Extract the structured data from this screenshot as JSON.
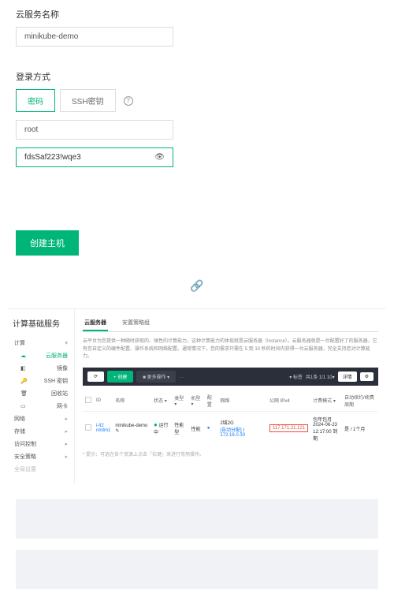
{
  "form": {
    "name_label": "云服务名称",
    "name_value": "minikube-demo",
    "login_label": "登录方式",
    "tab_password": "密码",
    "tab_ssh": "SSH密钥",
    "user_value": "root",
    "pwd_value": "fdsSaf223!wqe3"
  },
  "create_btn": "创建主机",
  "console": {
    "side_title": "计算基础服务",
    "menu": {
      "compute": "计算",
      "server": "云服务器",
      "image": "镜像",
      "ssh": "SSH 密钥",
      "recycle": "回收站",
      "nic": "网卡",
      "network": "网络",
      "storage": "存储",
      "access": "访问控制",
      "security": "安全策略",
      "global": "全局设置"
    },
    "tabs": {
      "t1": "云服务器",
      "t2": "安置策略组"
    },
    "desc": "云平台为您提供一种随时获取的、弹性的计算能力，这种计算能力的体现就是云服务器（Instance）。云服务器就是一台配置好了的服务器，它有您自定义的硬件配置、操作系统和网络配置。通常情况下，您的需求只需在 5 到 10 秒的时间内获得一台云服务器，完全支持您对计算能力。",
    "toolbar": {
      "reset": "⟳",
      "create": "+ 创建",
      "more": "■ 更多操作 ▾",
      "tag": "▾ 标签",
      "pager": "共1条   1/1 10▾",
      "detail": "详情",
      "cfg": "⚙"
    },
    "headers": {
      "id": "ID",
      "name": "名称",
      "status": "状态",
      "type": "类型",
      "model": "机型",
      "perf": "性能型",
      "cfg": "配置",
      "net": "网络",
      "pub": "公网 IPv4",
      "bill": "计费模式",
      "auto": "自动续约/续费周期"
    },
    "row": {
      "id1": "i-lt2",
      "id2": "nmtm1",
      "name": "minikube-demo",
      "status": "运行中",
      "type": "性能型",
      "perf": "性能",
      "cfg_icon": "●",
      "net1": "2域2G",
      "net2_a": "[自动分配]",
      "net2_b": "172.16.0.30",
      "pub": "117.171.21.121",
      "bill1": "包年包月",
      "bill2": "2024-06-23",
      "bill3": "12:17:00 到期",
      "auto": "是 / 1个月"
    },
    "tip": "* 提示：可选在各个资源上点击「右键」来进行常用操作。"
  }
}
